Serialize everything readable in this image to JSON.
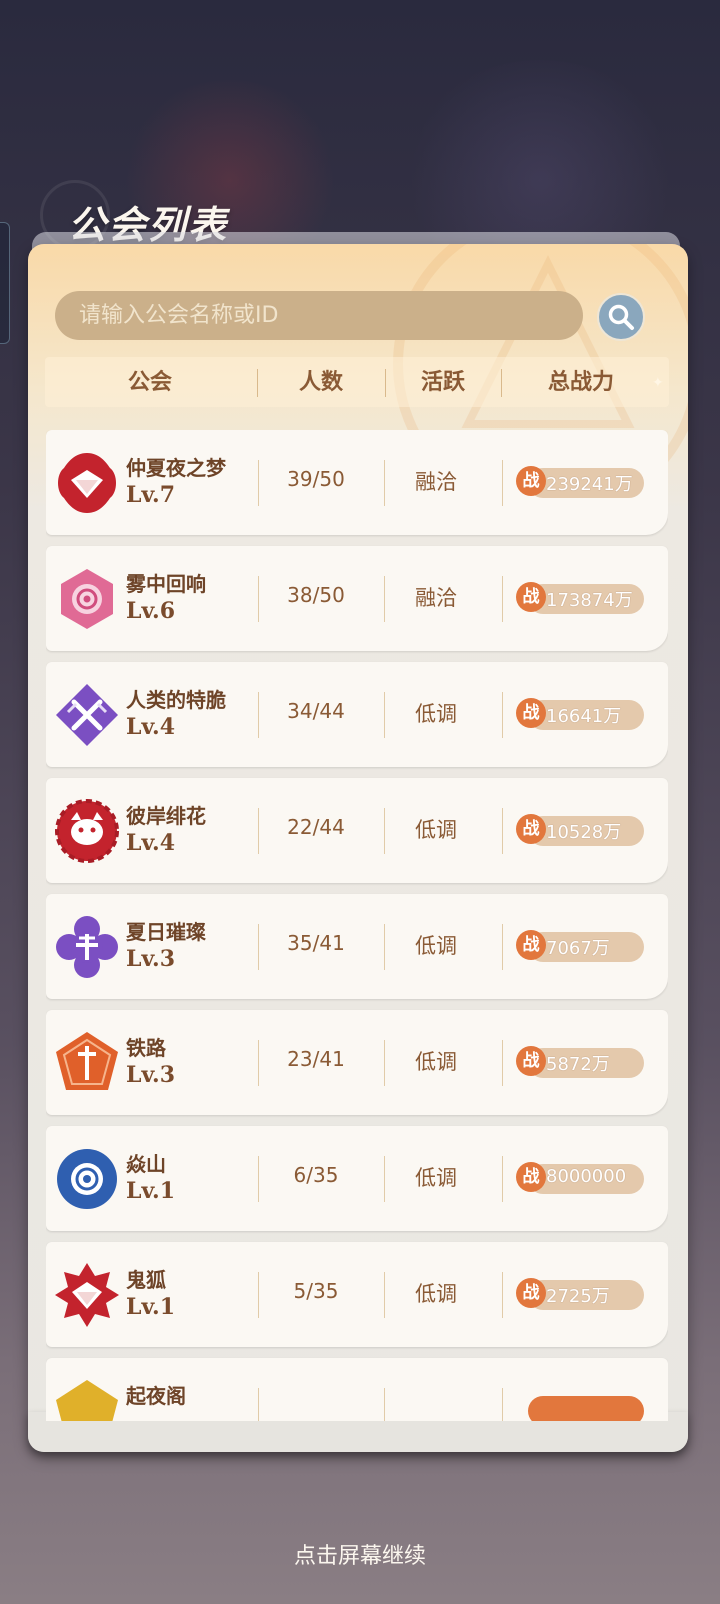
{
  "title": "公会列表",
  "search": {
    "placeholder": "请输入公会名称或ID"
  },
  "columns": [
    "公会",
    "人数",
    "活跃",
    "总战力"
  ],
  "power_icon_label": "战",
  "guilds": [
    {
      "name": "仲夏夜之梦",
      "level": "Lv.7",
      "members": "39/50",
      "activity": "融洽",
      "power": "239241万",
      "emblem": "red-diamond-emblem"
    },
    {
      "name": "雾中回响",
      "level": "Lv.6",
      "members": "38/50",
      "activity": "融洽",
      "power": "173874万",
      "emblem": "pink-rose-emblem"
    },
    {
      "name": "人类的特脆",
      "level": "Lv.4",
      "members": "34/44",
      "activity": "低调",
      "power": "16641万",
      "emblem": "purple-swords-emblem"
    },
    {
      "name": "彼岸绯花",
      "level": "Lv.4",
      "members": "22/44",
      "activity": "低调",
      "power": "10528万",
      "emblem": "red-cat-emblem"
    },
    {
      "name": "夏日璀璨",
      "level": "Lv.3",
      "members": "35/41",
      "activity": "低调",
      "power": "7067万",
      "emblem": "purple-bull-emblem"
    },
    {
      "name": "铁路",
      "level": "Lv.3",
      "members": "23/41",
      "activity": "低调",
      "power": "5872万",
      "emblem": "orange-sword-emblem"
    },
    {
      "name": "焱山",
      "level": "Lv.1",
      "members": "6/35",
      "activity": "低调",
      "power": "8000000",
      "emblem": "blue-rose-emblem"
    },
    {
      "name": "鬼狐",
      "level": "Lv.1",
      "members": "5/35",
      "activity": "低调",
      "power": "2725万",
      "emblem": "red-star-diamond-emblem"
    },
    {
      "name": "起夜阁",
      "level": "",
      "members": "",
      "activity": "",
      "power": "",
      "emblem": "yellow-emblem"
    }
  ],
  "footer": {
    "continue": "点击屏幕继续"
  },
  "colors": {
    "accent": "#e2773d",
    "text_brown": "#8a5a35",
    "search_bg": "#cbb08a",
    "search_button": "#8aa7bd"
  }
}
